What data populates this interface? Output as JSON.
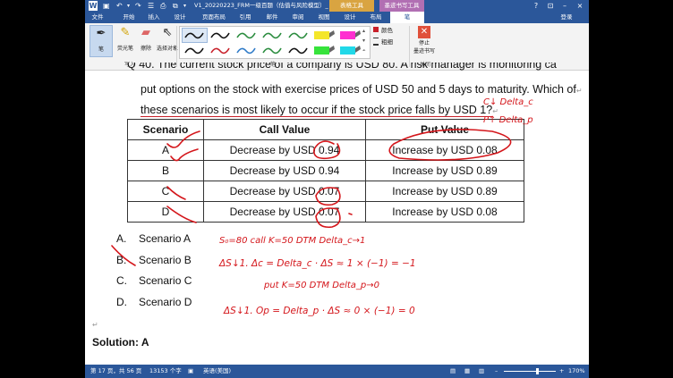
{
  "titlebar": {
    "title": "V1_20220223_FRM一级百题（估值与风险模型）_推课...",
    "context_group1": "表格工具",
    "context_group2": "墨迹书写工具",
    "login": "登录"
  },
  "tabs": [
    "文件",
    "开始",
    "插入",
    "设计",
    "页面布局",
    "引用",
    "邮件",
    "审阅",
    "视图",
    "设计",
    "布局",
    "笔"
  ],
  "ribbon": {
    "pen_label": "笔",
    "highlighter_label": "荧光笔",
    "eraser_label": "擦除",
    "select_label": "选择对象",
    "color_label": "颜色",
    "thickness_label": "粗细",
    "stop_label_1": "停止",
    "stop_label_2": "墨迹书写",
    "group_write": "写入",
    "group_pens": "笔",
    "group_close": "关闭",
    "pen_swatches": [
      {
        "color": "#111111",
        "kind": "line"
      },
      {
        "color": "#111111",
        "kind": "line"
      },
      {
        "color": "#2a8c3e",
        "kind": "line"
      },
      {
        "color": "#2a8c3e",
        "kind": "line"
      },
      {
        "color": "#2a8c3e",
        "kind": "line"
      },
      {
        "color": "#f4e62a",
        "kind": "hl"
      },
      {
        "color": "#ff2fd0",
        "kind": "hl"
      },
      {
        "color": "#111111",
        "kind": "line"
      },
      {
        "color": "#c8202a",
        "kind": "line"
      },
      {
        "color": "#2f7bc8",
        "kind": "line"
      },
      {
        "color": "#2a8c3e",
        "kind": "line"
      },
      {
        "color": "#111111",
        "kind": "line"
      },
      {
        "color": "#37e33b",
        "kind": "hl"
      },
      {
        "color": "#21d8e8",
        "kind": "hl"
      }
    ]
  },
  "document": {
    "q_cut_prefix": "Q 40.",
    "q_cut_text": "The current stock price of a company is USD 80. A risk manager is monitoring call and",
    "q_line2": "put options on the stock with exercise prices of USD 50 and 5 days to maturity. Which of",
    "q_line3": "these scenarios is most likely to occur if the stock price falls by USD 1?",
    "table": {
      "headers": [
        "Scenario",
        "Call Value",
        "Put Value"
      ],
      "rows": [
        [
          "A",
          "Decrease by USD 0.94",
          "Increase by USD 0.08"
        ],
        [
          "B",
          "Decrease by USD 0.94",
          "Increase by USD 0.89"
        ],
        [
          "C",
          "Decrease by USD 0.07",
          "Increase by USD 0.89"
        ],
        [
          "D",
          "Decrease by USD 0.07",
          "Increase by USD 0.08"
        ]
      ]
    },
    "options": [
      {
        "letter": "A.",
        "text": "Scenario A"
      },
      {
        "letter": "B.",
        "text": "Scenario B"
      },
      {
        "letter": "C.",
        "text": "Scenario C"
      },
      {
        "letter": "D.",
        "text": "Scenario D"
      }
    ],
    "solution": "Solution: A",
    "handwriting": {
      "margin_c": "C↓  Delta_c",
      "margin_p": "P↑  Delta_p",
      "n1": "S₀=80   call   K=50   DTM Delta_c→1",
      "n2": "ΔS↓1.   Δc = Delta_c · ΔS ≈ 1 × (−1) = −1",
      "n3": "put   K=50   DTM   Delta_p→0",
      "n4": "ΔS↓1.   Op = Delta_p · ΔS ≈ 0 × (−1) = 0"
    }
  },
  "statusbar": {
    "page": "第 17 页，共 56 页",
    "words": "13153 个字",
    "lang": "英语(美国)",
    "zoom": "170%"
  }
}
